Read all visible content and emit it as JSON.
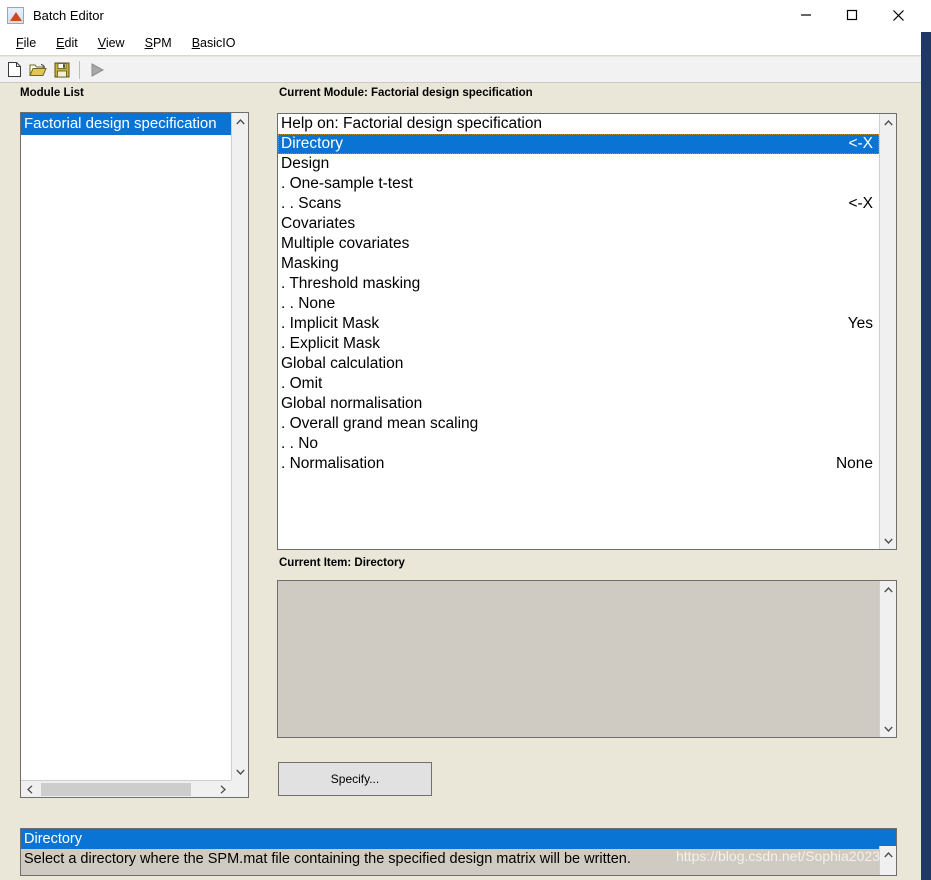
{
  "window": {
    "title": "Batch Editor",
    "icon": "matlab-icon",
    "minimize_label": "—",
    "maximize_label": "□",
    "close_label": "✕",
    "resize_corner_icon": "resize-arrow-icon"
  },
  "menubar": {
    "items": [
      {
        "label": "File",
        "mnemonic": "F"
      },
      {
        "label": "Edit",
        "mnemonic": "E"
      },
      {
        "label": "View",
        "mnemonic": "V"
      },
      {
        "label": "SPM",
        "mnemonic": "S"
      },
      {
        "label": "BasicIO",
        "mnemonic": "B"
      }
    ]
  },
  "toolbar": {
    "buttons": [
      {
        "name": "new-file-icon",
        "label": "New"
      },
      {
        "name": "open-folder-icon",
        "label": "Open"
      },
      {
        "name": "save-disk-icon",
        "label": "Save"
      },
      {
        "name": "run-play-icon",
        "label": "Run"
      }
    ]
  },
  "module_list": {
    "label": "Module List",
    "items": [
      {
        "label": "Factorial design specification",
        "selected": true
      }
    ]
  },
  "current_module": {
    "label": "Current Module: Factorial design specification",
    "rows": [
      {
        "label": "Help on: Factorial design specification",
        "value": "",
        "selected": false
      },
      {
        "label": "Directory",
        "value": "<-X",
        "selected": true
      },
      {
        "label": "Design",
        "value": "",
        "selected": false
      },
      {
        "label": ". One-sample t-test",
        "value": "",
        "selected": false
      },
      {
        "label": ". . Scans",
        "value": "<-X",
        "selected": false
      },
      {
        "label": "Covariates",
        "value": "",
        "selected": false
      },
      {
        "label": "Multiple covariates",
        "value": "",
        "selected": false
      },
      {
        "label": "Masking",
        "value": "",
        "selected": false
      },
      {
        "label": ". Threshold masking",
        "value": "",
        "selected": false
      },
      {
        "label": ". . None",
        "value": "",
        "selected": false
      },
      {
        "label": ". Implicit Mask",
        "value": "Yes",
        "selected": false
      },
      {
        "label": ". Explicit Mask",
        "value": "",
        "selected": false
      },
      {
        "label": "Global calculation",
        "value": "",
        "selected": false
      },
      {
        "label": ". Omit",
        "value": "",
        "selected": false
      },
      {
        "label": "Global normalisation",
        "value": "",
        "selected": false
      },
      {
        "label": ". Overall grand mean scaling",
        "value": "",
        "selected": false
      },
      {
        "label": ". . No",
        "value": "",
        "selected": false
      },
      {
        "label": ". Normalisation",
        "value": "None",
        "selected": false
      }
    ]
  },
  "current_item": {
    "label": "Current Item: Directory",
    "value": ""
  },
  "specify_button": {
    "label": "Specify..."
  },
  "help": {
    "title": "Directory",
    "body": "Select a directory where the SPM.mat file containing the specified design matrix will be written.",
    "watermark": "https://blog.csdn.net/Sophia2023"
  },
  "colors": {
    "window_background": "#EAE7D8",
    "selection_blue": "#0A74D4",
    "panel_grey": "#CFCBC2",
    "right_strip": "#1F3864"
  }
}
